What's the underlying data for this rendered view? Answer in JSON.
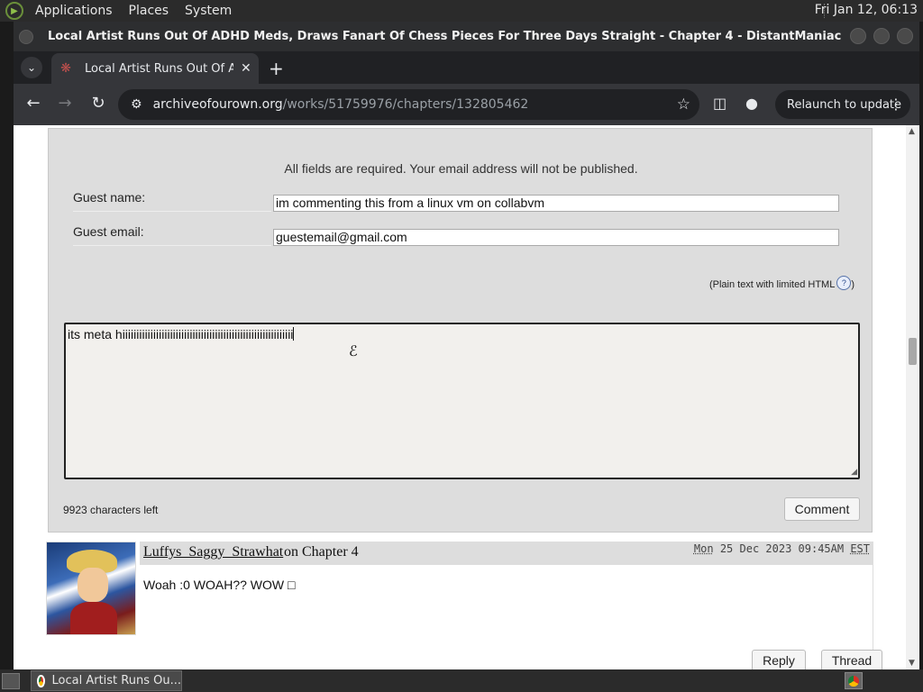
{
  "panel": {
    "menus": [
      "Applications",
      "Places",
      "System"
    ],
    "clock": "Fri Jan 12, 06:13"
  },
  "window": {
    "title": "Local Artist Runs Out Of ADHD Meds, Draws Fanart Of Chess Pieces For Three Days Straight - Chapter 4 - DistantManiacalLaughter - The Ama..."
  },
  "browser": {
    "tab_title": "Local Artist Runs Out Of ADHD Meds",
    "url_domain": "archiveofourown.org",
    "url_path": "/works/51759976/chapters/132805462",
    "relaunch_label": "Relaunch to update"
  },
  "form": {
    "note": "All fields are required. Your email address will not be published.",
    "guest_name_label": "Guest name:",
    "guest_name_value": "im commenting this from a linux vm on collabvm",
    "guest_email_label": "Guest email:",
    "guest_email_value": "guestemail@gmail.com",
    "plain_text_note": "(Plain text with limited HTML",
    "plain_text_close": ")",
    "help_symbol": "?",
    "comment_text": "its meta hiiiiiiiiiiiiiiiiiiiiiiiiiiiiiiiiiiiiiiiiiiiiiiiiiiiiiiiiiiiii",
    "chars_left": "9923 characters left",
    "submit_label": "Comment"
  },
  "comment": {
    "author": "Luffys_Saggy_Strawhat",
    "on_text": "on Chapter 4",
    "date_day": "Mon",
    "date_rest": " 25 Dec 2023 09:45AM ",
    "date_tz": "EST",
    "body": "Woah :0 WOAH?? WOW □",
    "reply_label": "Reply",
    "thread_label": "Thread"
  },
  "taskbar": {
    "task_label": "Local Artist Runs Ou..."
  },
  "icons": {
    "back": "←",
    "forward": "→",
    "reload": "↻",
    "star": "☆",
    "close": "✕",
    "plus": "+",
    "chevron": "⌄",
    "dots": "⋮"
  }
}
